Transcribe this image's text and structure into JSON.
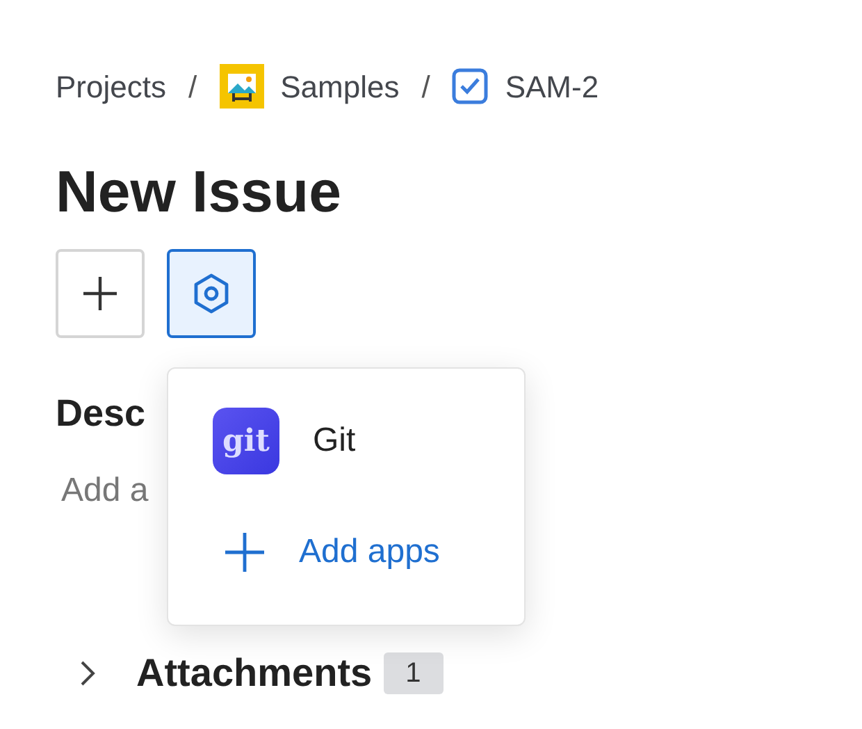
{
  "breadcrumbs": [
    {
      "label": "Projects",
      "kind": "text"
    },
    {
      "separator": "/",
      "label": "Samples",
      "kind": "project"
    },
    {
      "separator": "/",
      "label": "SAM-2",
      "kind": "issue"
    }
  ],
  "title": "New Issue",
  "toolbar": [
    {
      "kind": "add",
      "selected": false
    },
    {
      "kind": "apps",
      "selected": true
    }
  ],
  "apps_menu": {
    "items": [
      {
        "kind": "app",
        "label": "Git",
        "icon_text": "git"
      },
      {
        "kind": "add",
        "label": "Add apps"
      }
    ]
  },
  "description": {
    "heading": "Desc",
    "placeholder": "Add a"
  },
  "attachments": {
    "label": "Attachments",
    "count": "1",
    "expanded": false
  }
}
